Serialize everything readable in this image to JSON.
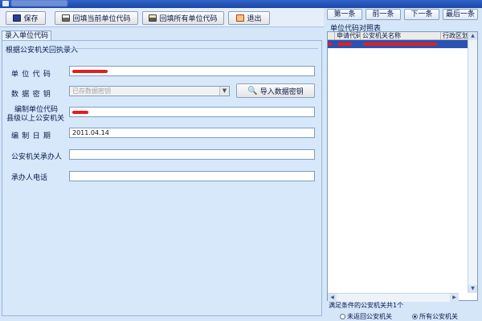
{
  "window": {
    "title": "单位代码维护"
  },
  "toolbar": {
    "save_label": "保存",
    "print_current_label": "回填当前单位代码",
    "print_all_label": "回填所有单位代码",
    "exit_label": "退出"
  },
  "tab": {
    "label": "录入单位代码"
  },
  "group": {
    "title": "根据公安机关回执录入"
  },
  "form": {
    "unit_code_label": "单位代码",
    "unit_code_value": "",
    "db_password_label": "数据密钥",
    "db_password_placeholder": "已存数据密钥",
    "import_button_label": "导入数据密钥",
    "agency_label_line1": "编制单位代码",
    "agency_label_line2": "县级以上公安机关",
    "agency_value": "",
    "date_label": "编制日期",
    "date_value": "2011.04.14",
    "handler_label": "公安机关承办人",
    "handler_value": "",
    "phone_label": "承办人电话",
    "phone_value": ""
  },
  "navigation": {
    "first_label": "第一条",
    "prev_label": "前一条",
    "next_label": "下一条",
    "last_label": "最后一条"
  },
  "list": {
    "title": "单位代码对照表",
    "columns": [
      "申请代码",
      "公安机关名称",
      "行政区划"
    ],
    "rows": [
      {
        "code": "",
        "name": "",
        "region": ""
      }
    ]
  },
  "status": {
    "count_text": "满足条件的公安机关共1个",
    "radio_unreturned": "未返回公安机关",
    "radio_all": "所有公安机关",
    "selected": "radio_all"
  },
  "colors": {
    "title_bar": "#1c46a5",
    "redaction": "#e02020",
    "selection": "#2a53b4"
  }
}
